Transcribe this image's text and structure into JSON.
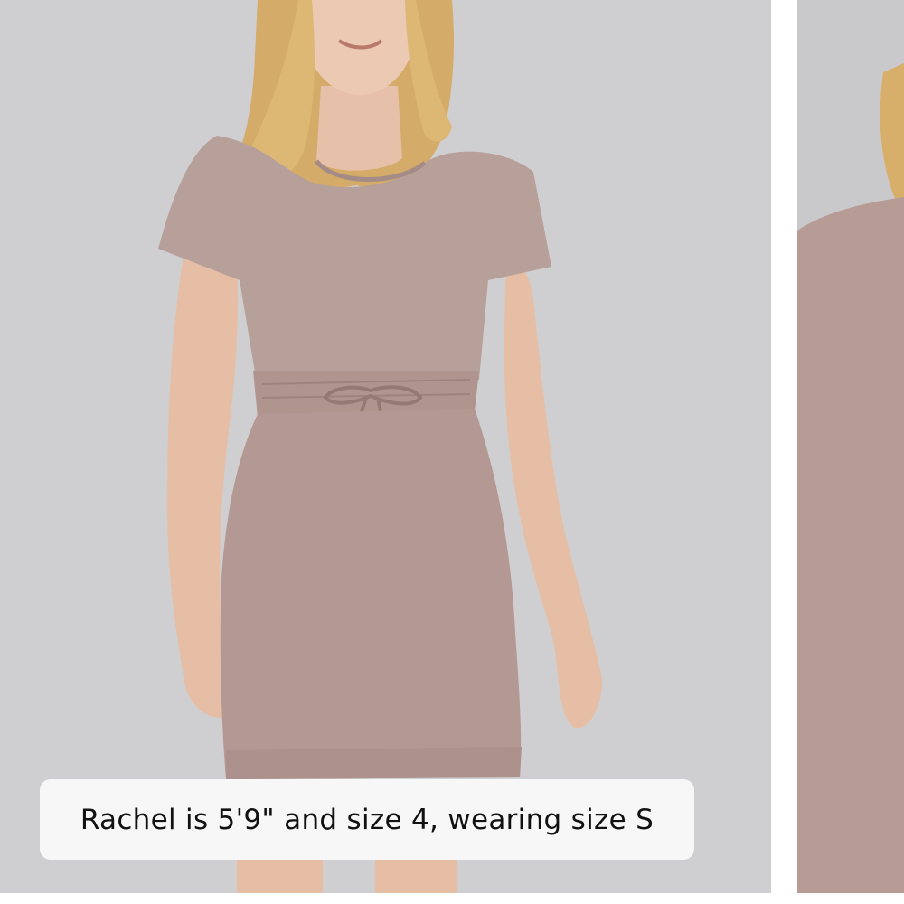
{
  "gallery": {
    "main_image_alt": "Model wearing a mauve short-sleeve drawstring-waist dress",
    "next_image_alt": "Close-up of mauve dress fabric",
    "caption": "Rachel is 5'9\" and size 4, wearing size S"
  },
  "colors": {
    "backdrop": "#cfcfd1",
    "dress": "#b59a95",
    "skin": "#e8c4ad",
    "hair": "#d9b26e",
    "caption_bg": "#f7f7f7",
    "caption_text": "#111111"
  }
}
